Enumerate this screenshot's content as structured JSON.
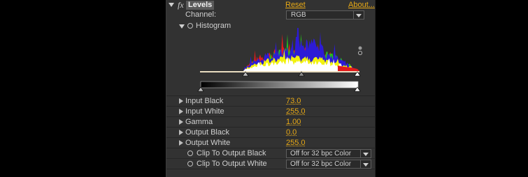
{
  "effect": {
    "name": "Levels",
    "fx_badge": "fx",
    "reset": "Reset",
    "about": "About..."
  },
  "channel": {
    "label": "Channel:",
    "value": "RGB"
  },
  "histogram": {
    "label": "Histogram",
    "colors": {
      "red": "#e21b1b",
      "green": "#25c11b",
      "blue": "#2d1bd6",
      "yellow": "#f2f20d",
      "white": "#ffffff"
    }
  },
  "params": [
    {
      "label": "Input Black",
      "value": "73.0"
    },
    {
      "label": "Input White",
      "value": "255.0"
    },
    {
      "label": "Gamma",
      "value": "1.00"
    },
    {
      "label": "Output Black",
      "value": "0.0"
    },
    {
      "label": "Output White",
      "value": "255.0"
    }
  ],
  "clip": [
    {
      "label": "Clip To Output Black",
      "value": "Off for 32 bpc Color"
    },
    {
      "label": "Clip To Output White",
      "value": "Off for 32 bpc Color"
    }
  ],
  "colors": {
    "panel": "#323232",
    "accent": "#e8a915"
  }
}
